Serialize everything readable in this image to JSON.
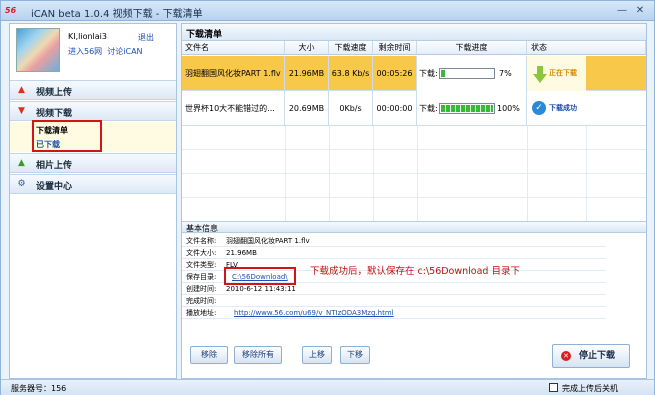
{
  "window": {
    "logo": "56",
    "title": "iCAN beta 1.0.4   视频下载 - 下载清单",
    "min": "—",
    "close": "✕"
  },
  "sidebar": {
    "username": "KI,lionlai3",
    "exit": "退出",
    "enter56": "进入56网",
    "discuss": "讨论iCAN",
    "nav": [
      {
        "label": "视频上传",
        "icon": "arrow-up-icon",
        "icon_color": "#d8331a"
      },
      {
        "label": "视频下载",
        "icon": "arrow-down-icon",
        "icon_color": "#d8331a"
      },
      {
        "label": "相片上传",
        "icon": "arrow-up-icon",
        "icon_color": "#3a9a2a"
      },
      {
        "label": "设置中心",
        "icon": "gear-icon",
        "icon_color": "#2a5aa0"
      }
    ],
    "download_sub": [
      "下载清单",
      "已下载"
    ]
  },
  "list": {
    "title": "下载清单",
    "columns": [
      "文件名",
      "大小",
      "下载速度",
      "剩余时间",
      "下载进度",
      "状态"
    ],
    "rows": [
      {
        "name": "羽翅翻国风化妆PART 1.flv",
        "size": "21.96MB",
        "speed": "63.8 Kb/s",
        "remaining": "00:05:26",
        "progress_label": "下载:",
        "progress": 0.07,
        "progress_text": "7%",
        "status": "正在下载"
      },
      {
        "name": "世界杯10大不能错过的...",
        "size": "20.69MB",
        "speed": "0Kb/s",
        "remaining": "00:00:00",
        "progress_label": "下载:",
        "progress": 1.0,
        "progress_text": "100%",
        "status": "下载成功"
      }
    ]
  },
  "info": {
    "title": "基本信息",
    "fields": [
      {
        "k": "文件名称:",
        "v": "羽翅翻国风化妆PART 1.flv"
      },
      {
        "k": "文件大小:",
        "v": "21.96MB"
      },
      {
        "k": "文件类型:",
        "v": "FLV"
      },
      {
        "k": "保存目录:",
        "v": "C:\\56Download\\"
      },
      {
        "k": "创建时间:",
        "v": "2010-6-12 11:43:11"
      },
      {
        "k": "完成时间:",
        "v": ""
      },
      {
        "k": "播放地址:",
        "v": "http://www.56.com/u69/v_NTIzODA3Mzg.html"
      }
    ],
    "annotation": "下载成功后，默认保存在 c:\\56Download 目录下"
  },
  "buttons": {
    "remove": "移除",
    "remove_all": "移除所有",
    "move_up": "上移",
    "move_down": "下移",
    "stop": "停止下载"
  },
  "status": {
    "server": "服务器号：156",
    "shutdown": "完成上传后关机"
  },
  "colors": {
    "active_row": "#f8c84a",
    "accent": "#d41414",
    "progress": "#3ab83a"
  }
}
